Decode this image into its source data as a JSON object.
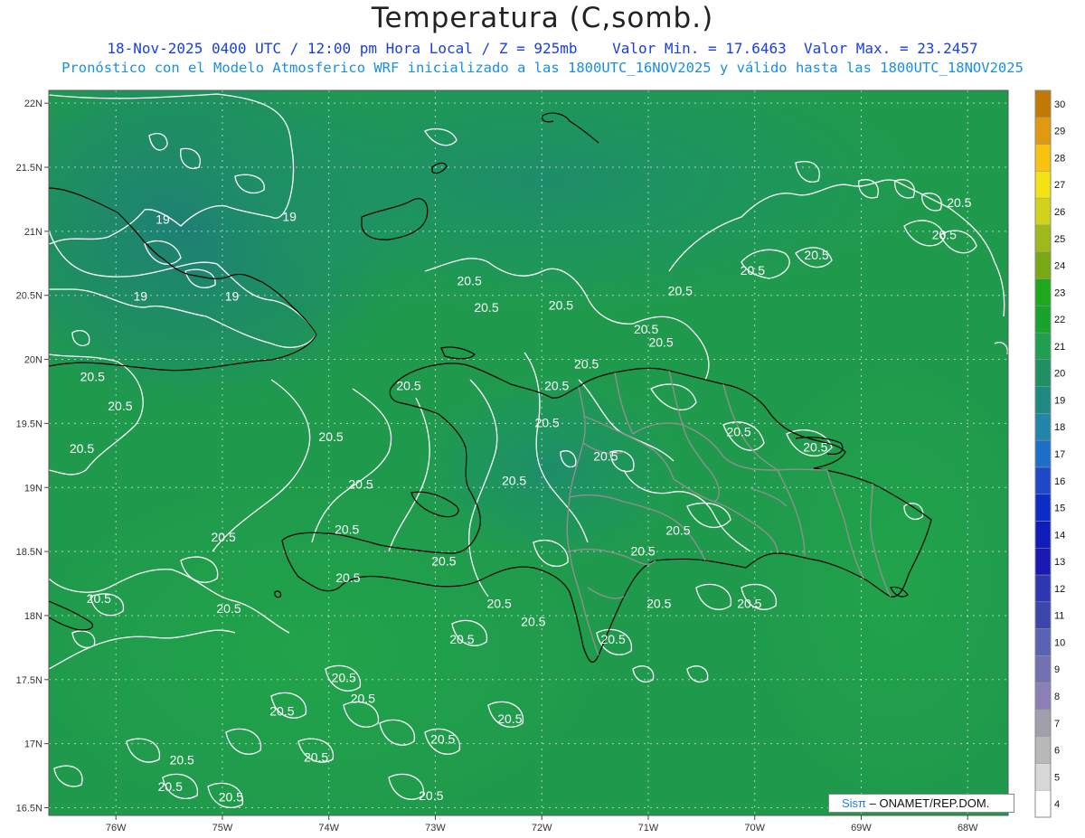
{
  "header": {
    "title": "Temperatura (C,somb.)",
    "subtitle_parts": [
      "18-Nov-2025 0400 UTC / 12:00 pm Hora Local / Z = 925mb",
      "Valor Min. = 17.6463",
      "Valor Max. = 23.2457"
    ],
    "subtitle2": "Pronóstico con el Modelo Atmosferico WRF inicializado a las 1800UTC_16NOV2025 y válido hasta las  1800UTC_18NOV2025"
  },
  "map": {
    "lat_labels": [
      "22N",
      "21.5N",
      "21N",
      "20.5N",
      "20N",
      "19.5N",
      "19N",
      "18.5N",
      "18N",
      "17.5N",
      "17N",
      "16.5N"
    ],
    "lat_values": [
      22,
      21.5,
      21,
      20.5,
      20,
      19.5,
      19,
      18.5,
      18,
      17.5,
      17,
      16.5
    ],
    "lon_labels": [
      "76W",
      "75W",
      "74W",
      "73W",
      "72W",
      "71W",
      "70W",
      "69W",
      "68W"
    ],
    "lon_values": [
      -76,
      -75,
      -74,
      -73,
      -72,
      -71,
      -70,
      -69,
      -68
    ],
    "lat_range": [
      16.44,
      22.1
    ],
    "lon_range": [
      -76.63,
      -67.62
    ],
    "contour_labels": [
      {
        "text": "19",
        "lon": -75.56,
        "lat": 21.06
      },
      {
        "text": "19",
        "lon": -74.37,
        "lat": 21.08
      },
      {
        "text": "19",
        "lon": -75.77,
        "lat": 20.46
      },
      {
        "text": "19",
        "lon": -74.91,
        "lat": 20.46
      },
      {
        "text": "20.5",
        "lon": -72.68,
        "lat": 20.58
      },
      {
        "text": "20.5",
        "lon": -72.52,
        "lat": 20.37
      },
      {
        "text": "20.5",
        "lon": -71.82,
        "lat": 20.39
      },
      {
        "text": "20.5",
        "lon": -70.7,
        "lat": 20.5
      },
      {
        "text": "20.5",
        "lon": -69.42,
        "lat": 20.78
      },
      {
        "text": "20.5",
        "lon": -70.02,
        "lat": 20.66
      },
      {
        "text": "20.5",
        "lon": -68.22,
        "lat": 20.94
      },
      {
        "text": "20.5",
        "lon": -68.08,
        "lat": 21.19
      },
      {
        "text": "20.5",
        "lon": -71.02,
        "lat": 20.2
      },
      {
        "text": "20.5",
        "lon": -70.88,
        "lat": 20.1
      },
      {
        "text": "20.5",
        "lon": -71.58,
        "lat": 19.93
      },
      {
        "text": "20.5",
        "lon": -71.86,
        "lat": 19.76
      },
      {
        "text": "20.5",
        "lon": -73.25,
        "lat": 19.76
      },
      {
        "text": "20.5",
        "lon": -76.22,
        "lat": 19.83
      },
      {
        "text": "20.5",
        "lon": -75.96,
        "lat": 19.6
      },
      {
        "text": "20.5",
        "lon": -76.32,
        "lat": 19.27
      },
      {
        "text": "20.5",
        "lon": -71.95,
        "lat": 19.47
      },
      {
        "text": "20.5",
        "lon": -73.98,
        "lat": 19.36
      },
      {
        "text": "20.5",
        "lon": -70.15,
        "lat": 19.4
      },
      {
        "text": "20.5",
        "lon": -69.43,
        "lat": 19.28
      },
      {
        "text": "20.5",
        "lon": -73.7,
        "lat": 18.99
      },
      {
        "text": "20.5",
        "lon": -72.26,
        "lat": 19.02
      },
      {
        "text": "20.5",
        "lon": -71.4,
        "lat": 19.21
      },
      {
        "text": "20.5",
        "lon": -73.83,
        "lat": 18.64
      },
      {
        "text": "20.5",
        "lon": -74.99,
        "lat": 18.58
      },
      {
        "text": "20.5",
        "lon": -70.72,
        "lat": 18.63
      },
      {
        "text": "20.5",
        "lon": -71.05,
        "lat": 18.47
      },
      {
        "text": "20.5",
        "lon": -72.92,
        "lat": 18.39
      },
      {
        "text": "20.5",
        "lon": -73.82,
        "lat": 18.26
      },
      {
        "text": "20.5",
        "lon": -76.16,
        "lat": 18.1
      },
      {
        "text": "20.5",
        "lon": -74.94,
        "lat": 18.02
      },
      {
        "text": "20.5",
        "lon": -72.4,
        "lat": 18.06
      },
      {
        "text": "20.5",
        "lon": -70.9,
        "lat": 18.06
      },
      {
        "text": "20.5",
        "lon": -70.05,
        "lat": 18.06
      },
      {
        "text": "20.5",
        "lon": -72.08,
        "lat": 17.92
      },
      {
        "text": "20.5",
        "lon": -72.75,
        "lat": 17.78
      },
      {
        "text": "20.5",
        "lon": -71.33,
        "lat": 17.78
      },
      {
        "text": "20.5",
        "lon": -73.86,
        "lat": 17.48
      },
      {
        "text": "20.5",
        "lon": -73.68,
        "lat": 17.32
      },
      {
        "text": "20.5",
        "lon": -74.44,
        "lat": 17.22
      },
      {
        "text": "20.5",
        "lon": -72.3,
        "lat": 17.16
      },
      {
        "text": "20.5",
        "lon": -72.93,
        "lat": 17.0
      },
      {
        "text": "20.5",
        "lon": -74.12,
        "lat": 16.86
      },
      {
        "text": "20.5",
        "lon": -75.38,
        "lat": 16.84
      },
      {
        "text": "20.5",
        "lon": -75.49,
        "lat": 16.63
      },
      {
        "text": "20.5",
        "lon": -74.92,
        "lat": 16.55
      },
      {
        "text": "20.5",
        "lon": -73.04,
        "lat": 16.56
      }
    ]
  },
  "colorbar": {
    "labels": [
      "4",
      "5",
      "6",
      "7",
      "8",
      "9",
      "10",
      "11",
      "12",
      "13",
      "14",
      "15",
      "16",
      "17",
      "18",
      "19",
      "20",
      "21",
      "22",
      "23",
      "24",
      "25",
      "26",
      "27",
      "28",
      "29",
      "30"
    ],
    "colors": [
      "#ffffff",
      "#d8d8d8",
      "#b8b8b8",
      "#a0a0ab",
      "#8c7fb8",
      "#7272b2",
      "#5a62b2",
      "#3c45aa",
      "#2e36b4",
      "#1919b2",
      "#0d1cba",
      "#0d2cc8",
      "#1e48c8",
      "#1c6ec8",
      "#2286aa",
      "#1c8a82",
      "#1e9064",
      "#1fa050",
      "#18a22e",
      "#1ea81c",
      "#78a812",
      "#a0b81a",
      "#d2d21a",
      "#f2e414",
      "#f8c210",
      "#e09a10",
      "#c27a06"
    ]
  },
  "credit": {
    "sis": "Sisπ",
    "text": " – ONAMET/REP.DOM."
  },
  "colors": {
    "title_blue": "#1a3fe0",
    "subtitle_cyan": "#1a8fe0",
    "sea_green": "#1f9a48",
    "coast_black": "#000000",
    "border_gray": "#8f8f8f",
    "contour_white": "#ffffff"
  }
}
